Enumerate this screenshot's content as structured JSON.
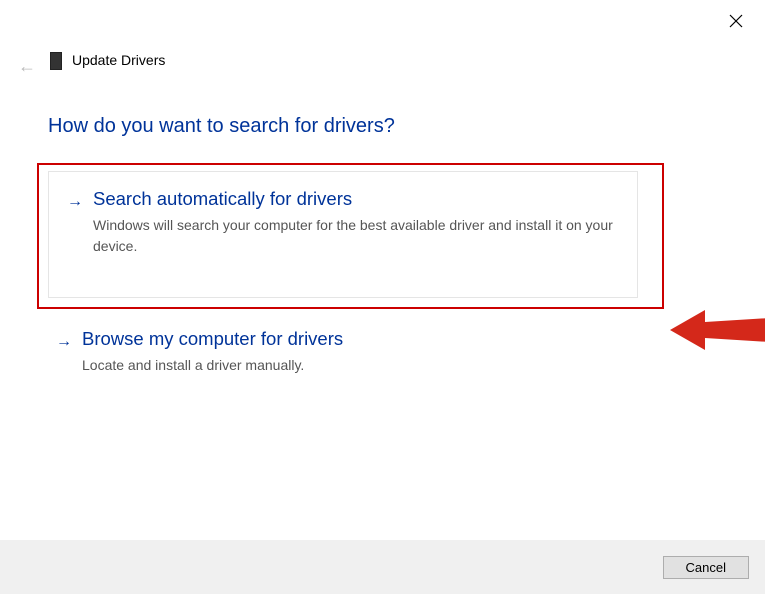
{
  "header": {
    "title": "Update Drivers"
  },
  "heading": "How do you want to search for drivers?",
  "options": {
    "auto": {
      "title": "Search automatically for drivers",
      "description": "Windows will search your computer for the best available driver and install it on your device."
    },
    "browse": {
      "title": "Browse my computer for drivers",
      "description": "Locate and install a driver manually."
    }
  },
  "footer": {
    "cancel_label": "Cancel"
  }
}
